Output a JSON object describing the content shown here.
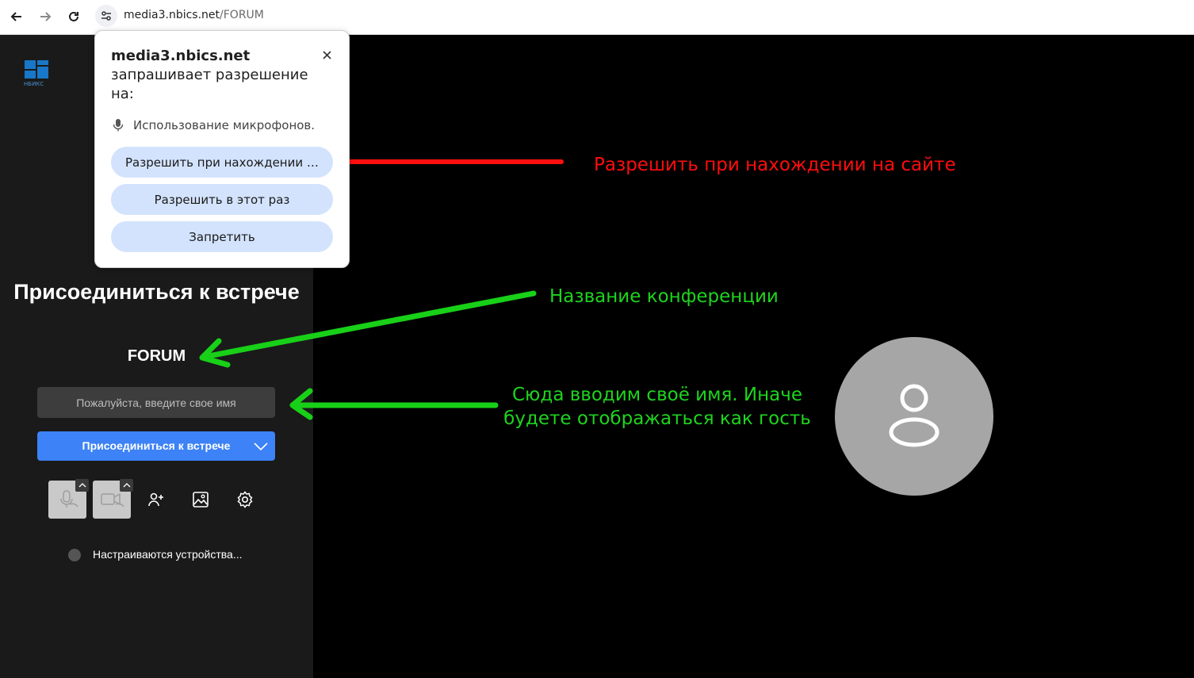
{
  "browser": {
    "url_host": "media3.nbics.net",
    "url_path": "/FORUM"
  },
  "logo": {
    "text": "НБИКС"
  },
  "prejoin": {
    "title": "Присоединиться к встрече",
    "room_name": "FORUM",
    "name_placeholder": "Пожалуйста, введите свое имя",
    "join_label": "Присоединиться к встрече",
    "status_text": "Настраиваются устройства..."
  },
  "permission_popup": {
    "site": "media3.nbics.net",
    "request_text": "запрашивает разрешение на:",
    "permission": "Использование микрофонов.",
    "allow_while_visiting": "Разрешить при нахождении на сайте",
    "allow_this_time": "Разрешить в этот раз",
    "block": "Запретить"
  },
  "annotations": {
    "allow_note": "Разрешить при нахождении на сайте",
    "room_note": "Название конференции",
    "name_note_line1": "Сюда вводим своё имя. Иначе",
    "name_note_line2": "будете отображаться как гость"
  },
  "colors": {
    "join_button": "#3d82f6",
    "popup_button": "#d3e3fd",
    "red_annotation": "#ff0d0d",
    "green_annotation": "#1ed41e",
    "avatar": "#a6a6a6"
  }
}
